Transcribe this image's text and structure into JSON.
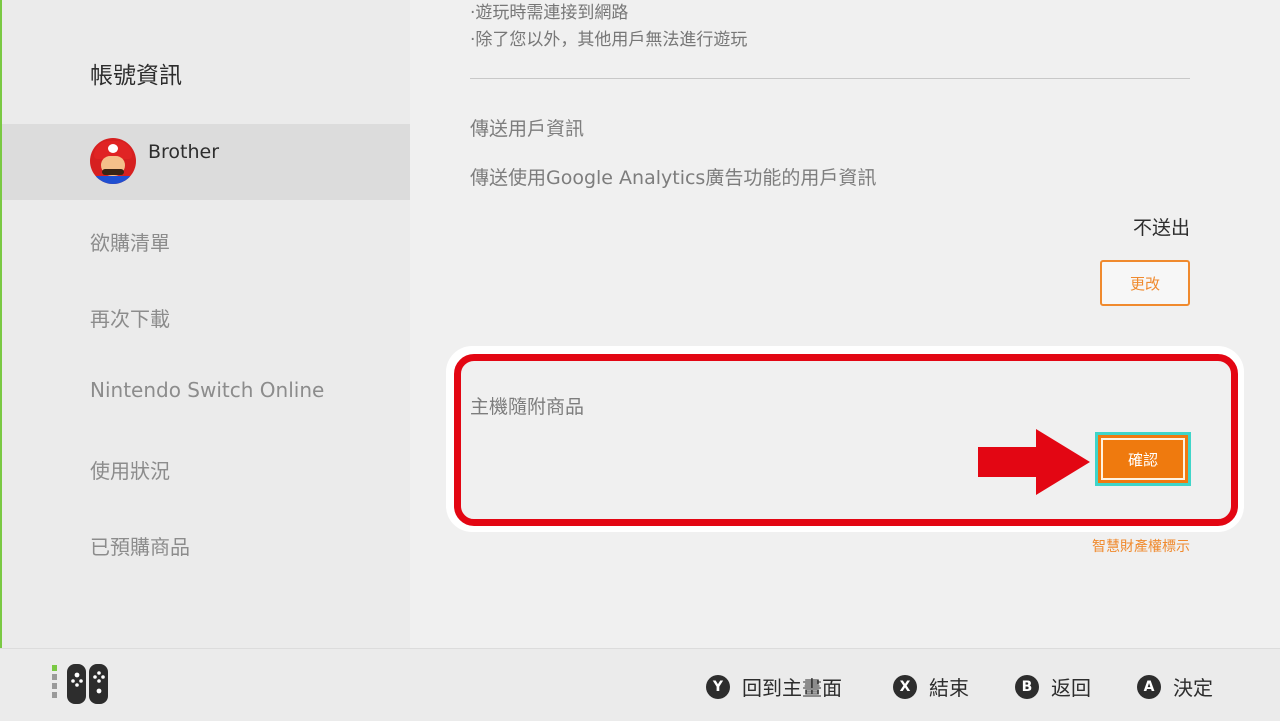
{
  "sidebar": {
    "title": "帳號資訊",
    "user_name": "Brother",
    "items": [
      {
        "label": "欲購清單"
      },
      {
        "label": "再次下載"
      },
      {
        "label": "Nintendo Switch Online"
      },
      {
        "label": "使用狀況"
      },
      {
        "label": "已預購商品"
      }
    ]
  },
  "main": {
    "notes": [
      "·遊玩時需連接到網路",
      "·除了您以外，其他用戶無法進行遊玩"
    ],
    "send_info_title": "傳送用戶資訊",
    "send_info_desc": "傳送使用Google Analytics廣告功能的用戶資訊",
    "send_info_value": "不送出",
    "change_label": "更改",
    "bundle_title": "主機隨附商品",
    "confirm_label": "確認",
    "ip_link": "智慧財產權標示"
  },
  "footer": {
    "hints": [
      {
        "button": "Y",
        "label": "回到主畫面"
      },
      {
        "button": "X",
        "label": "結束"
      },
      {
        "button": "B",
        "label": "返回"
      },
      {
        "button": "A",
        "label": "決定"
      }
    ]
  },
  "colors": {
    "accent_orange": "#f08a2e",
    "highlight_red": "#e30613",
    "focus_cyan": "#3fd5c9"
  }
}
